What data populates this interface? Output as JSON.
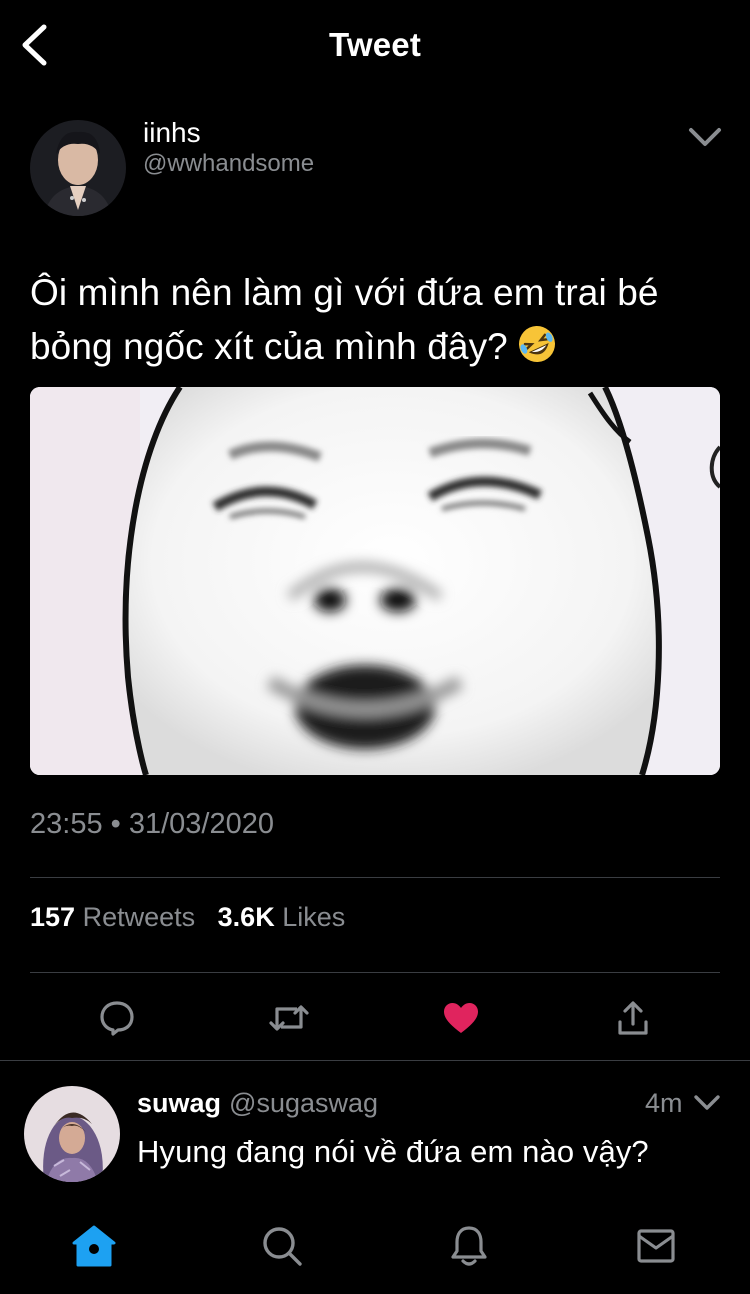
{
  "header": {
    "title": "Tweet"
  },
  "tweet": {
    "author_name": "iinhs",
    "author_handle": "@wwhandsome",
    "text": "Ôi mình nên làm gì với đứa em trai bé bỏng ngốc xít của mình đây?",
    "emoji": "rolling-on-floor-laughing-emoji",
    "timestamp": "23:55 • 31/03/2020",
    "retweets_count": "157",
    "retweets_label": "Retweets",
    "likes_count": "3.6K",
    "likes_label": "Likes",
    "liked": true
  },
  "reply": {
    "author_name": "suwag",
    "author_handle": "@sugaswag",
    "time": "4m",
    "text": "Hyung đang nói về đứa em nào vậy?"
  },
  "colors": {
    "background": "#000000",
    "secondary_text": "#8a8d91",
    "accent": "#1da1f2",
    "like": "#e0245e",
    "divider": "#3a3d42"
  },
  "icons": {
    "back": "chevron-left-icon",
    "caret": "chevron-down-icon",
    "reply": "reply-icon",
    "retweet": "retweet-icon",
    "like": "heart-icon",
    "share": "share-icon",
    "home": "home-icon",
    "search": "search-icon",
    "notifications": "bell-icon",
    "messages": "mail-icon"
  },
  "tabs": [
    "home",
    "search",
    "notifications",
    "messages"
  ],
  "active_tab": "home"
}
